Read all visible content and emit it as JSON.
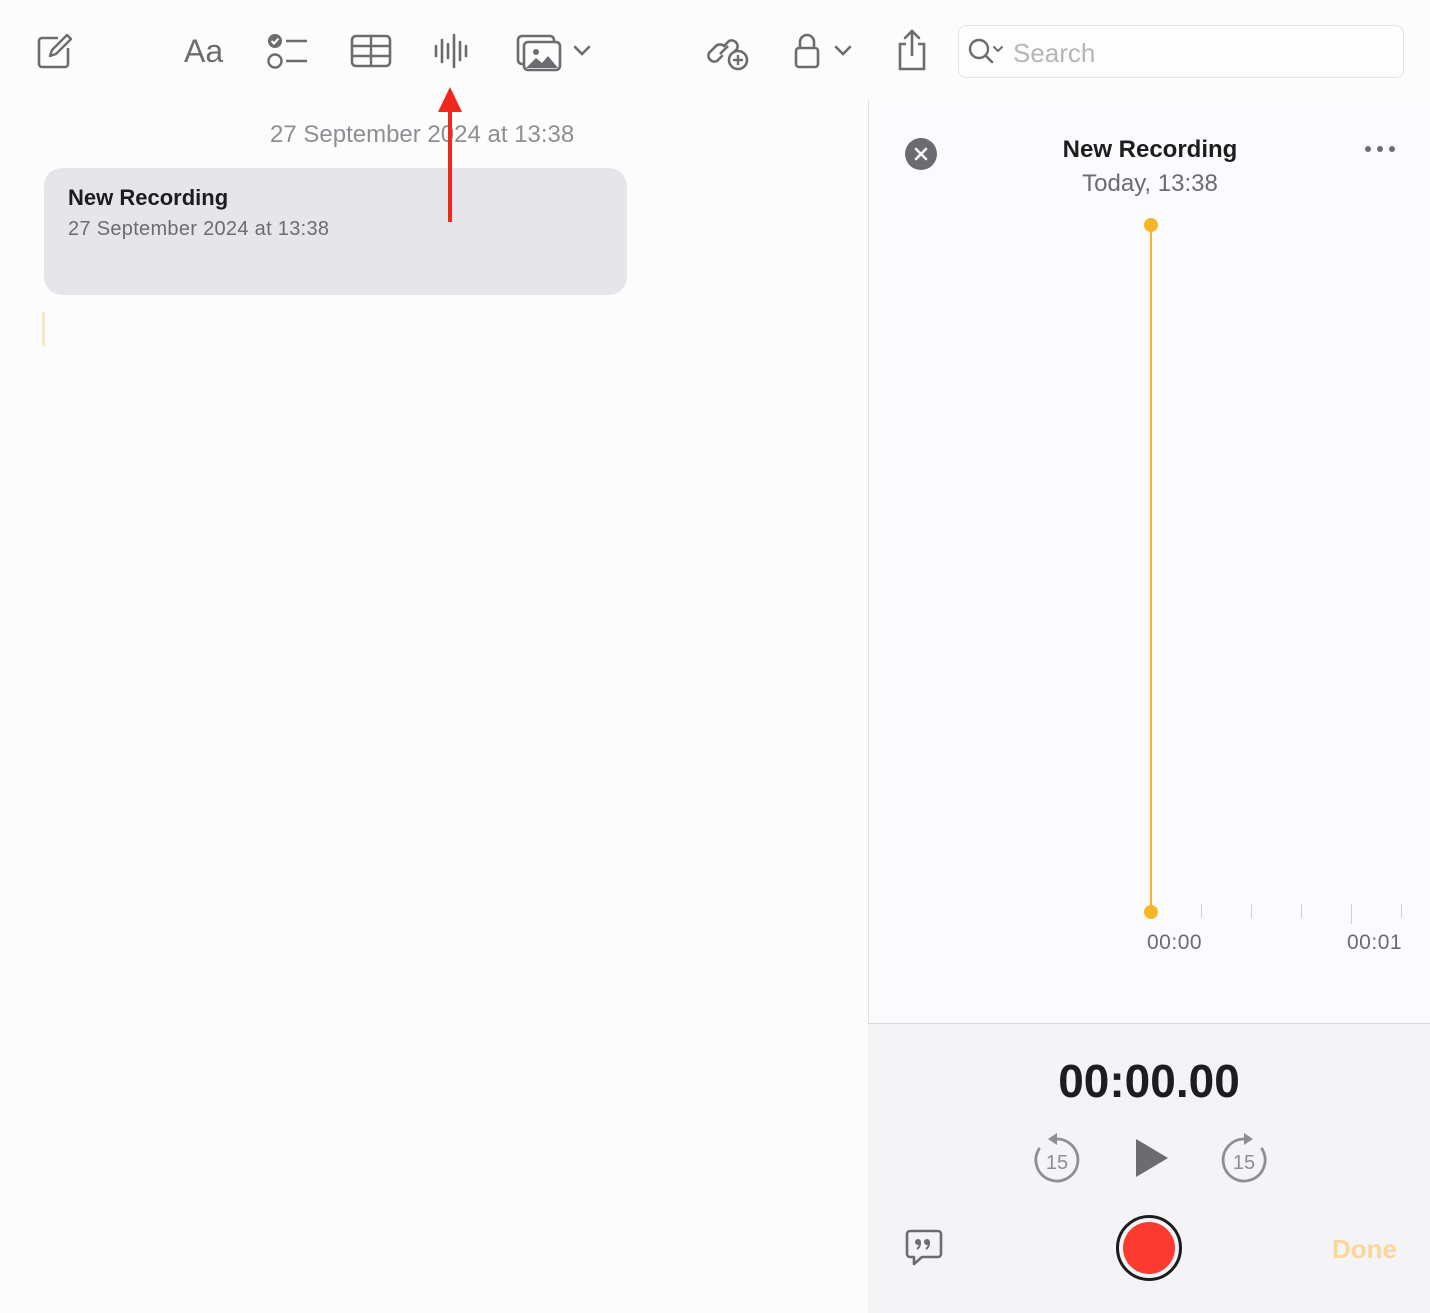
{
  "toolbar": {
    "icons": [
      "compose-icon",
      "format-text-icon",
      "checklist-icon",
      "table-icon",
      "audio-waveform-icon",
      "media-icon",
      "chevron-down-icon",
      "collaborate-icon",
      "lock-icon",
      "share-icon"
    ],
    "format_label": "Aa",
    "search": {
      "placeholder": "Search",
      "value": ""
    }
  },
  "note": {
    "date": "27 September 2024 at 13:38",
    "recording_card": {
      "title": "New Recording",
      "date": "27 September 2024 at 13:38"
    }
  },
  "recording_panel": {
    "title": "New Recording",
    "subtitle": "Today, 13:38",
    "timeline_labels": [
      "00:00",
      "00:01"
    ],
    "elapsed": "00:00.00",
    "skip_back_seconds": "15",
    "skip_forward_seconds": "15",
    "done_label": "Done"
  },
  "colors": {
    "accent": "#f7b52a",
    "record": "#fc3b30",
    "annotation_arrow": "#f0271b",
    "card_bg": "#e6e5ea",
    "icon_gray": "#6c6c70"
  }
}
